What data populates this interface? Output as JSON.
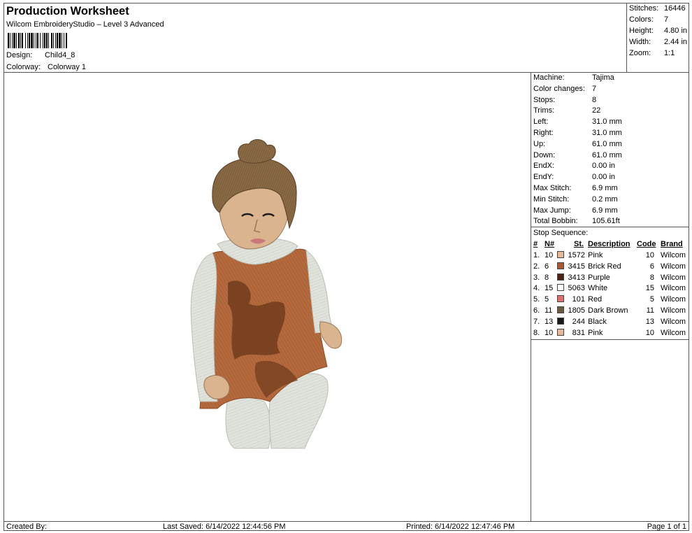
{
  "header": {
    "title": "Production Worksheet",
    "subtitle": "Wilcom EmbroideryStudio – Level 3 Advanced",
    "design_label": "Design:",
    "design_value": "Child4_8",
    "colorway_label": "Colorway:",
    "colorway_value": "Colorway 1"
  },
  "summary": {
    "stitches_label": "Stitches:",
    "stitches_value": "16446",
    "colors_label": "Colors:",
    "colors_value": "7",
    "height_label": "Height:",
    "height_value": "4.80 in",
    "width_label": "Width:",
    "width_value": "2.44 in",
    "zoom_label": "Zoom:",
    "zoom_value": "1:1"
  },
  "machine_info": [
    {
      "label": "Machine:",
      "value": "Tajima"
    },
    {
      "label": "Color changes:",
      "value": "7"
    },
    {
      "label": "Stops:",
      "value": "8"
    },
    {
      "label": "Trims:",
      "value": "22"
    },
    {
      "label": "Left:",
      "value": "31.0 mm"
    },
    {
      "label": "Right:",
      "value": "31.0 mm"
    },
    {
      "label": "Up:",
      "value": "61.0 mm"
    },
    {
      "label": "Down:",
      "value": "61.0 mm"
    },
    {
      "label": "EndX:",
      "value": "0.00 in"
    },
    {
      "label": "EndY:",
      "value": "0.00 in"
    },
    {
      "label": "Max Stitch:",
      "value": "6.9 mm"
    },
    {
      "label": "Min Stitch:",
      "value": "0.2 mm"
    },
    {
      "label": "Max Jump:",
      "value": "6.9 mm"
    },
    {
      "label": "Total Bobbin:",
      "value": "105.61ft"
    }
  ],
  "stop_sequence": {
    "title": "Stop Sequence:",
    "columns": {
      "num": "#",
      "n": "N#",
      "st": "St.",
      "description": "Description",
      "code": "Code",
      "brand": "Brand"
    },
    "rows": [
      {
        "num": "1.",
        "n": "10",
        "color": "#e8b898",
        "st": "1572",
        "description": "Pink",
        "code": "10",
        "brand": "Wilcom"
      },
      {
        "num": "2.",
        "n": "6",
        "color": "#a85a30",
        "st": "3415",
        "description": "Brick Red",
        "code": "6",
        "brand": "Wilcom"
      },
      {
        "num": "3.",
        "n": "8",
        "color": "#4a2410",
        "st": "3413",
        "description": "Purple",
        "code": "8",
        "brand": "Wilcom"
      },
      {
        "num": "4.",
        "n": "15",
        "color": "#ffffff",
        "st": "5063",
        "description": "White",
        "code": "15",
        "brand": "Wilcom"
      },
      {
        "num": "5.",
        "n": "5",
        "color": "#e07070",
        "st": "101",
        "description": "Red",
        "code": "5",
        "brand": "Wilcom"
      },
      {
        "num": "6.",
        "n": "11",
        "color": "#6b5a40",
        "st": "1805",
        "description": "Dark Brown",
        "code": "11",
        "brand": "Wilcom"
      },
      {
        "num": "7.",
        "n": "13",
        "color": "#1a1a1a",
        "st": "244",
        "description": "Black",
        "code": "13",
        "brand": "Wilcom"
      },
      {
        "num": "8.",
        "n": "10",
        "color": "#e8b898",
        "st": "831",
        "description": "Pink",
        "code": "10",
        "brand": "Wilcom"
      }
    ]
  },
  "footer": {
    "created_by": "Created By:",
    "last_saved": "Last Saved: 6/14/2022 12:44:56 PM",
    "printed": "Printed: 6/14/2022 12:47:46 PM",
    "page": "Page 1 of 1"
  },
  "artwork": {
    "icon": "embroidery-child-figure",
    "colors": {
      "skin": "#d9b48e",
      "hair": "#8a6a45",
      "dress": "#b46a3c",
      "dress_dark": "#6e3a1c",
      "white_fabric": "#dfe3dc",
      "lips": "#c97a78"
    }
  }
}
